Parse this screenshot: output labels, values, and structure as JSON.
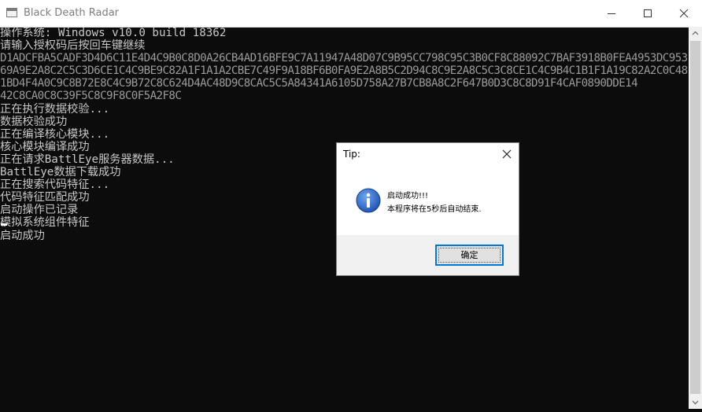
{
  "window": {
    "title": "Black Death Radar",
    "controls": {
      "minimize": "minimize",
      "maximize": "maximize",
      "close": "close"
    }
  },
  "console": {
    "lines": [
      {
        "text": "操作系统: Windows v10.0 build 18362",
        "faint": false
      },
      {
        "text": "请输入授权码后按回车键继续",
        "faint": false
      },
      {
        "text": "D1ADCFBA5CADF3D4D6C11E4D4C9B0C8D0A26CB4AD16BFE9C7A11947A48D07C9B95CC798C95C3B0CF8C88092C7BAF3918B0FEA4953DC953",
        "faint": true
      },
      {
        "text": "69A9E2A8C2C5C3D6CE1C4C9BE9C82A1F1A1A2CBE7C49F9A18BF6B0FA9E2A8B5C2D94C8C9E2A8C5C3C8CE1C4C9B4C1B1F1A19C82A2C0C48",
        "faint": true
      },
      {
        "text": "1BD4F4A0C9C8B72E8C4C9B72C8C624D4AC48D9C8CAC5C5A84341A6105D758A27B7CB8A8C2F647B0D3C8C8D91F4CAF0890DDE14",
        "faint": true
      },
      {
        "text": "42C8CA0C8C39F5C8C9F8C0F5A2F8C",
        "faint": true
      },
      {
        "text": "正在执行数据校验...",
        "faint": false
      },
      {
        "text": "数据校验成功",
        "faint": false
      },
      {
        "text": "正在编译核心模块...",
        "faint": false
      },
      {
        "text": "核心模块编译成功",
        "faint": false
      },
      {
        "text": "正在请求BattlEye服务器数据...",
        "faint": false
      },
      {
        "text": "BattlEye数据下载成功",
        "faint": false
      },
      {
        "text": "正在搜索代码特征...",
        "faint": false
      },
      {
        "text": "代码特征匹配成功",
        "faint": false
      },
      {
        "text": "启动操作已记录",
        "faint": false
      },
      {
        "text": "模拟系统组件特征",
        "faint": false
      },
      {
        "text": "启动成功",
        "faint": false
      }
    ]
  },
  "dialog": {
    "title": "Tip:",
    "icon": "info-icon",
    "message_line1": "启动成功!!!",
    "message_line2": "本程序将在5秒后自动结束.",
    "ok_label": "确定"
  },
  "colors": {
    "console_bg": "#0c0c0c",
    "console_text": "#c8c8c8",
    "accent": "#0078d7",
    "dialog_footer": "#f0f0f0"
  }
}
